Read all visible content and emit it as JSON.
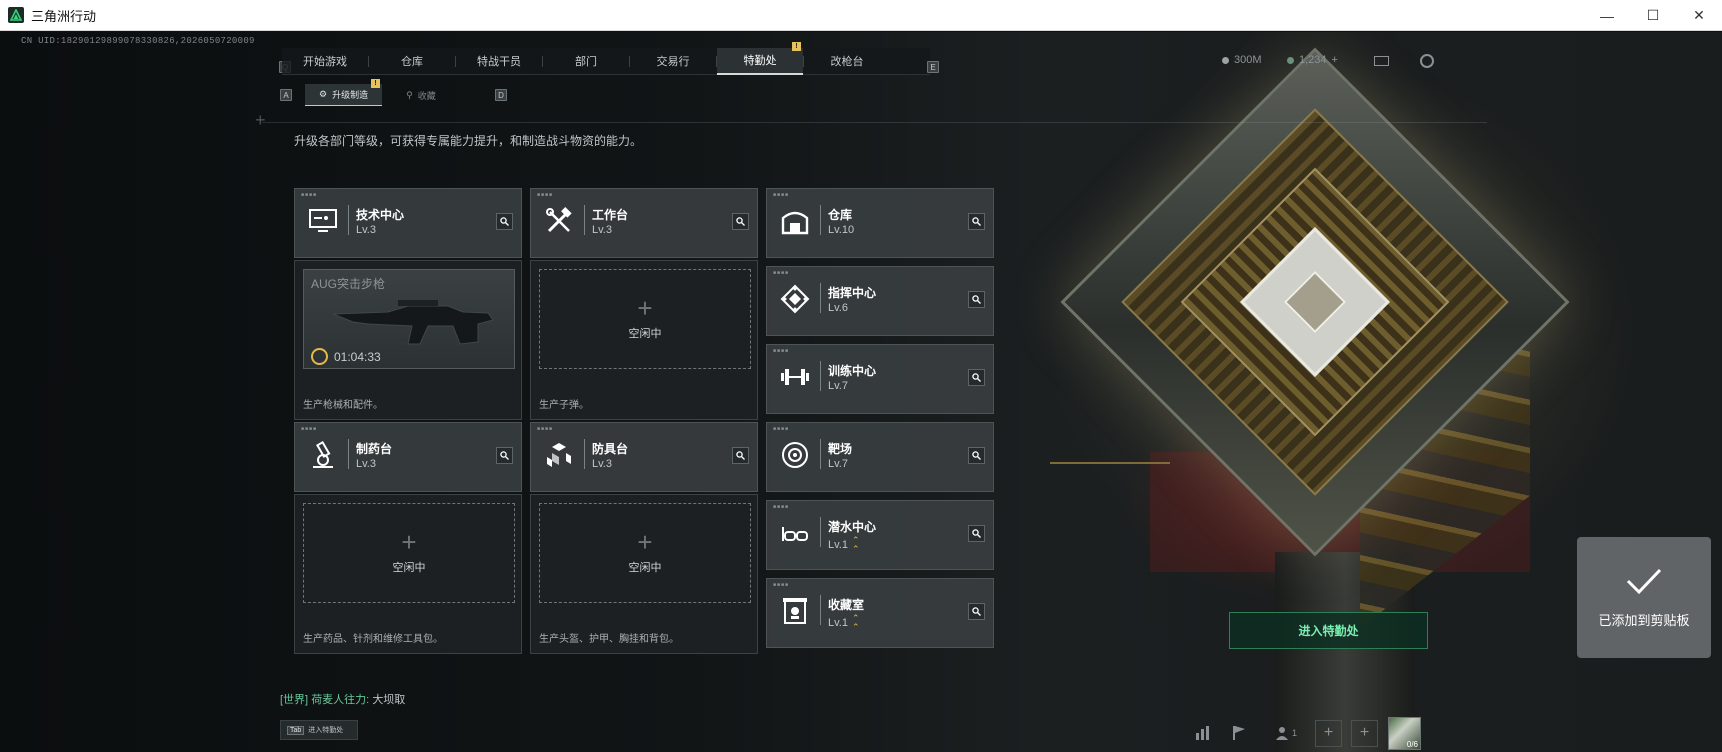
{
  "window": {
    "title": "三角洲行动",
    "minimize": "—",
    "maximize": "☐",
    "close": "✕"
  },
  "uid": "CN UID:18290129899078330826,2026050720009",
  "nav": {
    "left_key": "Q",
    "right_key": "E",
    "tabs": [
      {
        "label": "开始游戏"
      },
      {
        "label": "仓库"
      },
      {
        "label": "特战干员"
      },
      {
        "label": "部门"
      },
      {
        "label": "交易行"
      },
      {
        "label": "特勤处",
        "active": true,
        "badge": "!"
      },
      {
        "label": "改枪台"
      }
    ]
  },
  "currency": {
    "coins": "300M",
    "tickets": "1,234",
    "plus": "+"
  },
  "subnav": {
    "left_key": "A",
    "right_key": "D",
    "tabs": [
      {
        "label": "升级制造",
        "active": true,
        "badge": "!"
      },
      {
        "label": "收藏"
      }
    ]
  },
  "description": "升级各部门等级，可获得专属能力提升，和制造战斗物资的能力。",
  "facilities": {
    "tech_center": {
      "name": "技术中心",
      "level": "Lv.3",
      "icon": "monitor-icon"
    },
    "workbench": {
      "name": "工作台",
      "level": "Lv.3",
      "icon": "tools-icon"
    },
    "pharmacy": {
      "name": "制药台",
      "level": "Lv.3",
      "icon": "microscope-icon"
    },
    "armor_bench": {
      "name": "防具台",
      "level": "Lv.3",
      "icon": "blocks-icon"
    },
    "storage": {
      "name": "仓库",
      "level": "Lv.10",
      "icon": "warehouse-icon"
    },
    "command": {
      "name": "指挥中心",
      "level": "Lv.6",
      "icon": "command-icon"
    },
    "training": {
      "name": "训练中心",
      "level": "Lv.7",
      "icon": "dumbbell-icon"
    },
    "range": {
      "name": "靶场",
      "level": "Lv.7",
      "icon": "target-icon"
    },
    "diving": {
      "name": "潜水中心",
      "level": "Lv.1",
      "icon": "goggles-icon"
    },
    "collection": {
      "name": "收藏室",
      "level": "Lv.1",
      "icon": "collection-icon"
    }
  },
  "production": {
    "tech_center": {
      "item": "AUG突击步枪",
      "timer": "01:04:33",
      "desc": "生产枪械和配件。"
    },
    "workbench": {
      "idle": "空闲中",
      "desc": "生产子弹。"
    },
    "pharmacy": {
      "idle": "空闲中",
      "desc": "生产药品、针剂和维修工具包。"
    },
    "armor_bench": {
      "idle": "空闲中",
      "desc": "生产头盔、护甲、胸挂和背包。"
    }
  },
  "enter_button": "进入特勤处",
  "toast": {
    "text": "已添加到剪贴板"
  },
  "chat": {
    "channel": "[世界]",
    "user": "荷麦人往力:",
    "message": "大坝取"
  },
  "tab_hint": {
    "key": "Tab",
    "label": "进入特勤处"
  },
  "party": {
    "count": "1"
  },
  "avatar_label": "0/6"
}
